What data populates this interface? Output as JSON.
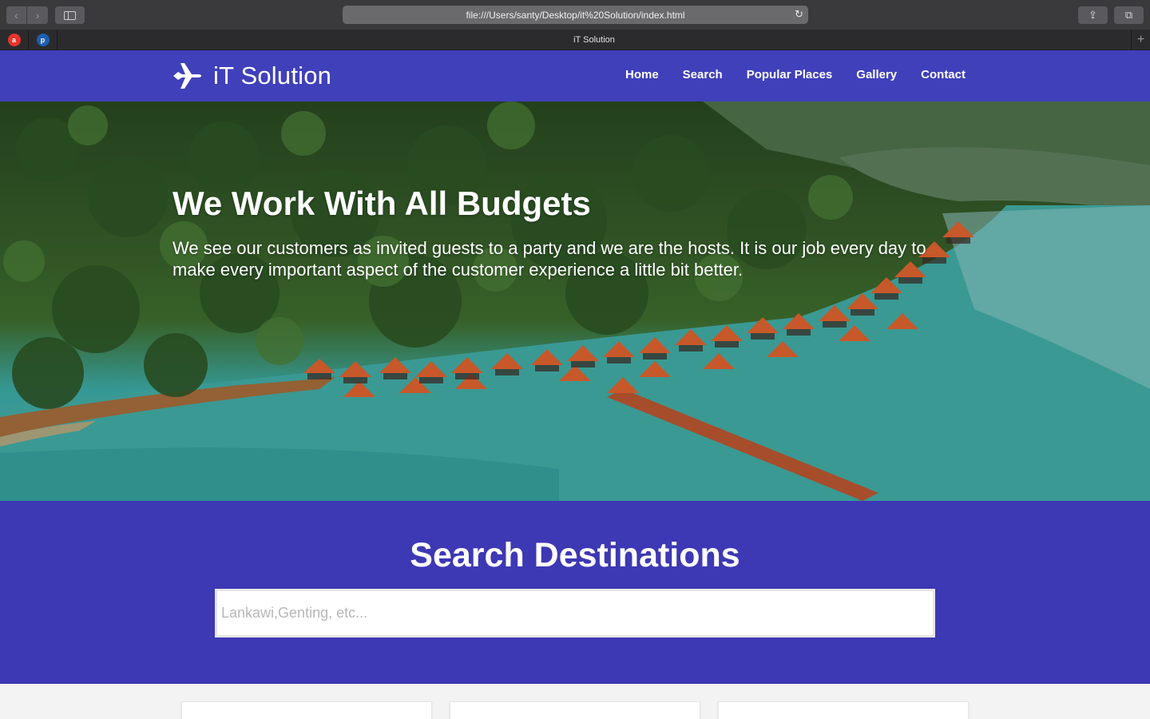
{
  "browser": {
    "url": "file:///Users/santy/Desktop/it%20Solution/index.html",
    "tab_title": "iT Solution",
    "back_glyph": "‹",
    "forward_glyph": "›",
    "reload_glyph": "↻",
    "share_glyph": "⇪",
    "tabs_glyph": "⧉",
    "new_tab_glyph": "+",
    "favicon1_letter": "a",
    "favicon2_letter": "p"
  },
  "header": {
    "logo_icon": "plane-icon",
    "logo_text": "iT Solution",
    "background": "#4040bb",
    "nav": [
      "Home",
      "Search",
      "Popular Places",
      "Gallery",
      "Contact"
    ]
  },
  "hero": {
    "title": "We Work With All Budgets",
    "subtitle": "We see our customers as invited guests to a party and we are the hosts. It is our job every day to make every important aspect of the customer experience a little bit better."
  },
  "search": {
    "title": "Search Destinations",
    "placeholder": "Lankawi,Genting, etc...",
    "value": "",
    "background": "#3d38b4"
  },
  "cards": {
    "count_visible": 3
  }
}
